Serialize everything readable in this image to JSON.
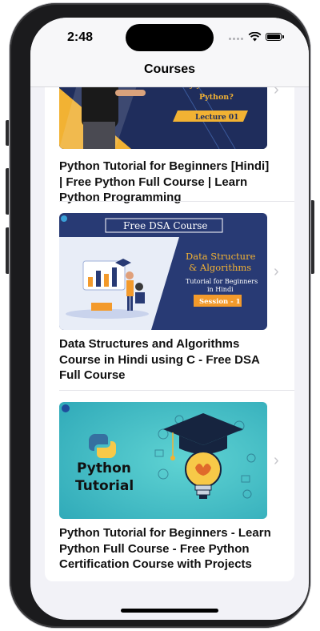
{
  "status_bar": {
    "time": "2:48"
  },
  "nav": {
    "title": "Courses"
  },
  "courses": [
    {
      "title": "Python Tutorial for Beginners [Hindi] | Free Python Full Course | Learn Python Programming",
      "thumb": {
        "headline": "Why you must learn Python?",
        "badge": "Lecture 01"
      }
    },
    {
      "title": "Data Structures and Algorithms Course in Hindi using C - Free DSA Full Course",
      "thumb": {
        "banner": "Free DSA Course",
        "heading_line1": "Data Structure",
        "heading_line2": "& Algorithms",
        "sub_line1": "Tutorial for Beginners",
        "sub_line2": "in Hindi",
        "badge": "Session - 1"
      }
    },
    {
      "title": "Python Tutorial for Beginners - Learn Python Full Course - Free Python Certification Course with Projects",
      "thumb": {
        "line1": "Python",
        "line2": "Tutorial"
      }
    }
  ],
  "colors": {
    "accent_gold": "#f2b233",
    "navy": "#1f2d5c",
    "teal": "#3cc3c6",
    "badge_orange": "#f39a2b"
  }
}
